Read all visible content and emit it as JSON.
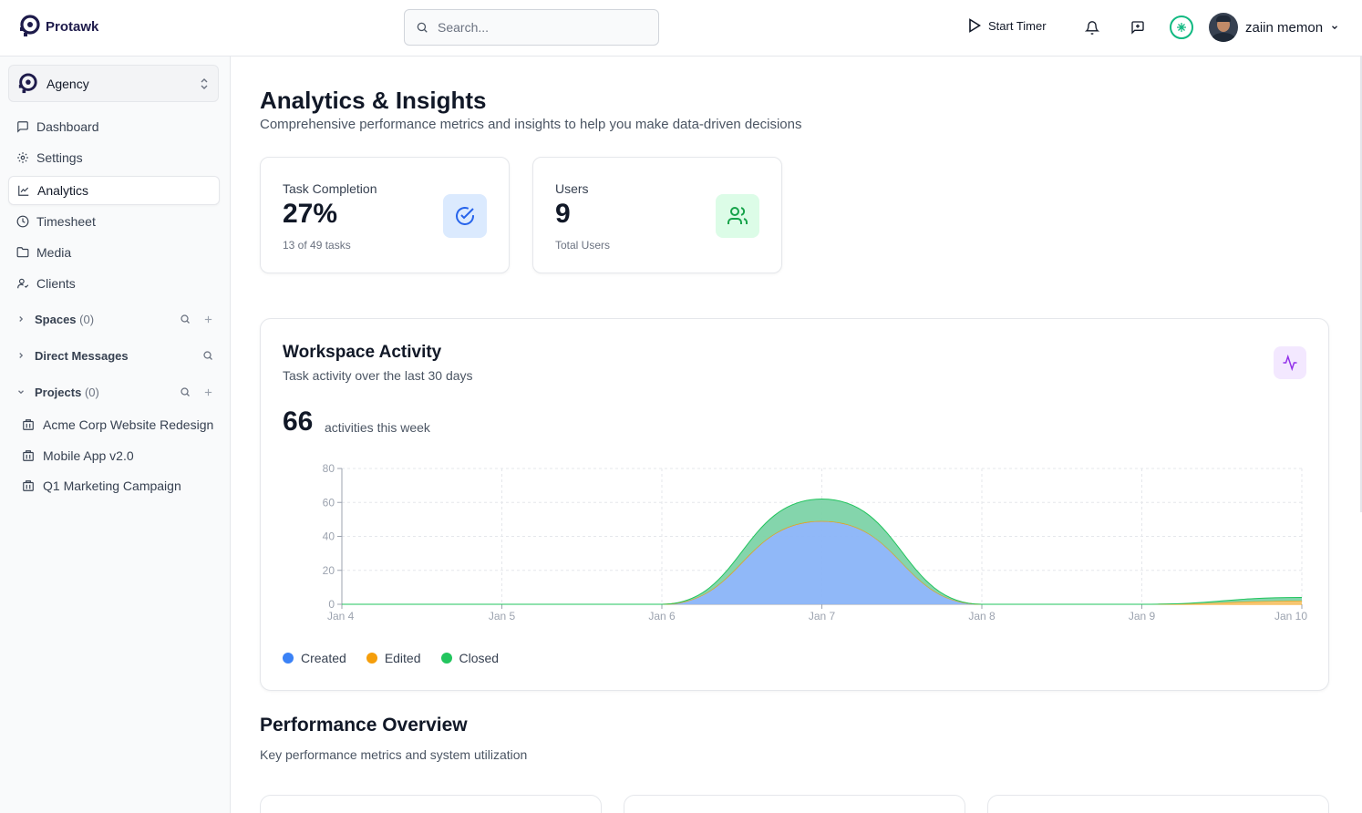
{
  "app": {
    "name": "Protawk"
  },
  "search": {
    "placeholder": "Search..."
  },
  "topbar": {
    "start_timer": "Start Timer",
    "user_name": "zaiin memon"
  },
  "sidebar": {
    "workspace": "Agency",
    "nav": [
      {
        "label": "Dashboard",
        "icon": "chat-icon"
      },
      {
        "label": "Settings",
        "icon": "gear-icon"
      },
      {
        "label": "Analytics",
        "icon": "chart-icon",
        "active": true
      },
      {
        "label": "Timesheet",
        "icon": "clock-icon"
      },
      {
        "label": "Media",
        "icon": "folder-icon"
      },
      {
        "label": "Clients",
        "icon": "user-icon"
      }
    ],
    "sections": {
      "spaces": {
        "label": "Spaces",
        "count": "(0)"
      },
      "dms": {
        "label": "Direct Messages"
      },
      "projects": {
        "label": "Projects",
        "count": "(0)"
      }
    },
    "projects": [
      "Acme Corp Website Redesign",
      "Mobile App v2.0",
      "Q1 Marketing Campaign"
    ]
  },
  "page": {
    "title": "Analytics & Insights",
    "subtitle": "Comprehensive performance metrics and insights to help you make data-driven decisions"
  },
  "stats": [
    {
      "label": "Task Completion",
      "value": "27%",
      "foot": "13 of 49 tasks",
      "icon": "check-circle-icon",
      "color": "#2563eb"
    },
    {
      "label": "Users",
      "value": "9",
      "foot": "Total Users",
      "icon": "users-icon",
      "color": "#16a34a"
    }
  ],
  "activity": {
    "title": "Workspace Activity",
    "subtitle": "Task activity over the last 30 days",
    "count": "66",
    "count_label": "activities this week"
  },
  "chart_data": {
    "type": "area",
    "stacked": true,
    "x": [
      "Jan 4",
      "Jan 5",
      "Jan 6",
      "Jan 7",
      "Jan 8",
      "Jan 9",
      "Jan 10"
    ],
    "ylim": [
      0,
      80
    ],
    "yticks": [
      0,
      20,
      40,
      60,
      80
    ],
    "grid": true,
    "legend_position": "bottom-left",
    "series": [
      {
        "name": "Created",
        "color": "#3b82f6",
        "values": [
          0,
          0,
          0,
          49,
          0,
          0,
          0
        ]
      },
      {
        "name": "Edited",
        "color": "#f59e0b",
        "values": [
          0,
          0,
          0,
          0,
          0,
          0,
          2
        ]
      },
      {
        "name": "Closed",
        "color": "#22c55e",
        "values": [
          0,
          0,
          0,
          13,
          0,
          0,
          2
        ]
      }
    ]
  },
  "performance": {
    "title": "Performance Overview",
    "subtitle": "Key performance metrics and system utilization"
  }
}
